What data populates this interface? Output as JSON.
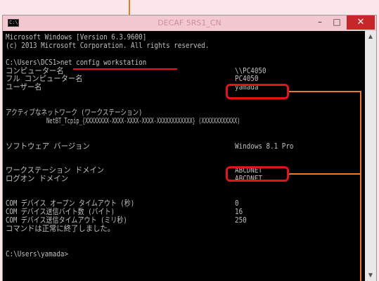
{
  "window": {
    "title": "DECAF 5RS1_CN",
    "minimize_label": "–",
    "maximize_label": "□",
    "close_label": "✕"
  },
  "icons": {
    "app": "cmd-icon",
    "scroll_up": "arrow-up-icon",
    "scroll_down": "arrow-down-icon"
  },
  "colors": {
    "highlight": "#e0141b",
    "callout": "#ec7a28",
    "console_bg": "#000000",
    "console_text": "#c0c0c0"
  },
  "console": {
    "version_line": "Microsoft Windows [Version 6.3.9600]",
    "copyright_line": "(c) 2013 Microsoft Corporation. All rights reserved.",
    "command_line": "C:\\Users\\DCS1>net config workstation",
    "fields": [
      {
        "label": "コンピューター名",
        "value": "\\\\PC4050"
      },
      {
        "label": "フル コンピューター名",
        "value": "PC4050"
      },
      {
        "label": "ユーザー名",
        "value": "yamada"
      },
      {
        "label": "アクティブなネットワーク (ワークステーション)",
        "value": ""
      },
      {
        "label": "NetBT_Tcpip_{XXXXXXXX-XXXX-XXXX-XXXX-XXXXXXXXXXXX} (XXXXXXXXXXXX)",
        "value": ""
      },
      {
        "label": "ソフトウェア バージョン",
        "value": "Windows 8.1 Pro"
      },
      {
        "label": "ワークステーション ドメイン",
        "value": "ABCDNET"
      },
      {
        "label": "ログオン ドメイン",
        "value": "ABCDNET"
      },
      {
        "label": "COM デバイス オープン タイムアウト (秒)",
        "value": "0"
      },
      {
        "label": "COM デバイス送信バイト数 (バイト)",
        "value": "16"
      },
      {
        "label": "COM デバイス送信タイムアウト (ミリ秒)",
        "value": "250"
      }
    ],
    "completion_line": "コマンドは正常に終了しました。",
    "prompt_line": "C:\\Users\\yamada>"
  }
}
